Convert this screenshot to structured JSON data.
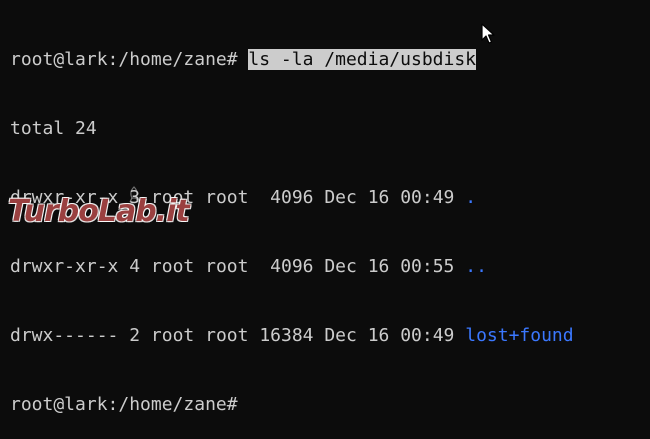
{
  "terminal": {
    "prompt": "root@lark:/home/zane#",
    "command": "ls -la /media/usbdisk",
    "total_line": "total 24",
    "entries": [
      {
        "perms": "drwxr-xr-x",
        "links": "3",
        "owner": "root",
        "group": "root",
        "size": " 4096",
        "date": "Dec 16 00:49",
        "name": "."
      },
      {
        "perms": "drwxr-xr-x",
        "links": "4",
        "owner": "root",
        "group": "root",
        "size": " 4096",
        "date": "Dec 16 00:55",
        "name": ".."
      },
      {
        "perms": "drwx------",
        "links": "2",
        "owner": "root",
        "group": "root",
        "size": "16384",
        "date": "Dec 16 00:49",
        "name": "lost+found"
      }
    ],
    "final_prompt": "root@lark:/home/zane#"
  },
  "watermark": {
    "text": "TurboLab.it"
  },
  "colors": {
    "background": "#0c0c0c",
    "foreground": "#cccccc",
    "directory": "#3b78ff",
    "selection_bg": "#cccccc",
    "watermark": "#780000"
  },
  "icons": {
    "pointer": "mouse-pointer-icon",
    "watermark_mark": "turbolab-logo-icon"
  }
}
